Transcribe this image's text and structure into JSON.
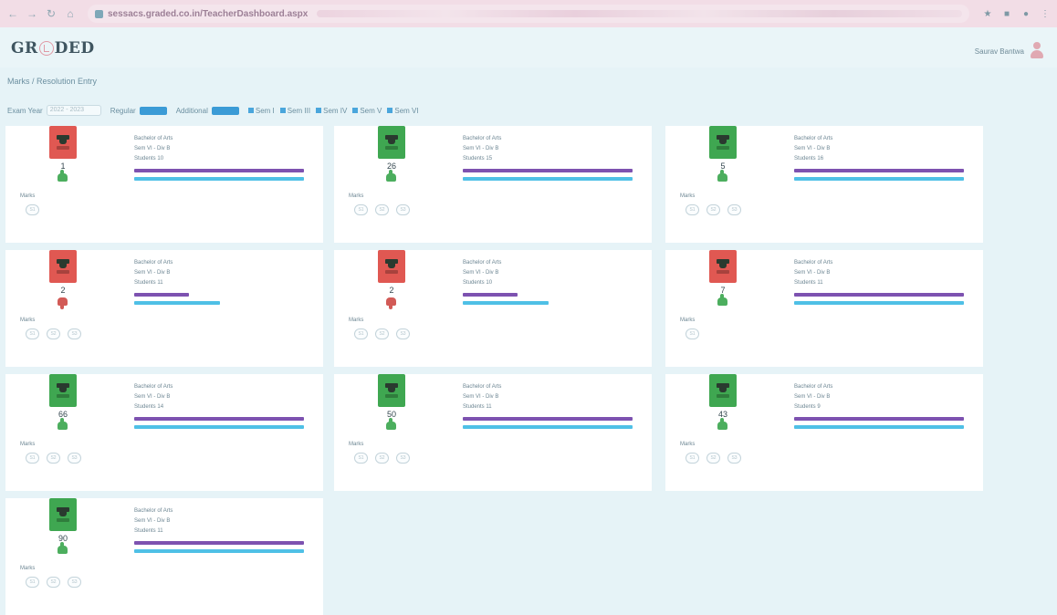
{
  "browser": {
    "url": "sessacs.graded.co.in/TeacherDashboard.aspx"
  },
  "header": {
    "logo_text_left": "GR",
    "logo_text_right": "DED",
    "user_name": "Saurav Bantwa"
  },
  "breadcrumb": "Marks / Resolution Entry",
  "filters": {
    "exam_year_label": "Exam Year",
    "exam_year_value": "2022 - 2023",
    "regular_label": "Regular",
    "additional_label": "Additional",
    "semesters": [
      "Sem I",
      "Sem III",
      "Sem IV",
      "Sem V",
      "Sem VI"
    ]
  },
  "cards": [
    {
      "count": "1",
      "status": "red",
      "thumb": "up",
      "info1": "Bachelor of Arts",
      "info2": "Sem VI - Div B",
      "info3": "Students 10",
      "chips": [
        "S1"
      ]
    },
    {
      "count": "26",
      "status": "green",
      "thumb": "up",
      "info1": "Bachelor of Arts",
      "info2": "Sem VI - Div B",
      "info3": "Students 15",
      "chips": [
        "S1",
        "S2",
        "S3"
      ]
    },
    {
      "count": "5",
      "status": "green",
      "thumb": "up",
      "info1": "Bachelor of Arts",
      "info2": "Sem VI - Div B",
      "info3": "Students 16",
      "chips": [
        "S1",
        "S2",
        "S3"
      ]
    },
    {
      "count": "2",
      "status": "red",
      "thumb": "down",
      "info1": "Bachelor of Arts",
      "info2": "Sem VI - Div B",
      "info3": "Students 11",
      "chips": [
        "S1",
        "S2",
        "S3"
      ]
    },
    {
      "count": "2",
      "status": "red",
      "thumb": "down",
      "info1": "Bachelor of Arts",
      "info2": "Sem VI - Div B",
      "info3": "Students 10",
      "chips": [
        "S1",
        "S2",
        "S3"
      ]
    },
    {
      "count": "7",
      "status": "red",
      "thumb": "up",
      "info1": "Bachelor of Arts",
      "info2": "Sem VI - Div B",
      "info3": "Students 11",
      "chips": [
        "S1"
      ]
    },
    {
      "count": "66",
      "status": "green",
      "thumb": "up",
      "info1": "Bachelor of Arts",
      "info2": "Sem VI - Div B",
      "info3": "Students 14",
      "chips": [
        "S1",
        "S2",
        "S3"
      ]
    },
    {
      "count": "50",
      "status": "green",
      "thumb": "up",
      "info1": "Bachelor of Arts",
      "info2": "Sem VI - Div B",
      "info3": "Students 11",
      "chips": [
        "S1",
        "S2",
        "S3"
      ]
    },
    {
      "count": "43",
      "status": "green",
      "thumb": "up",
      "info1": "Bachelor of Arts",
      "info2": "Sem VI - Div B",
      "info3": "Students 9",
      "chips": [
        "S1",
        "S2",
        "S3"
      ]
    },
    {
      "count": "90",
      "status": "green",
      "thumb": "up",
      "info1": "Bachelor of Arts",
      "info2": "Sem VI - Div B",
      "info3": "Students 11",
      "chips": [
        "S1",
        "S2",
        "S3"
      ]
    }
  ],
  "marks_label": "Marks",
  "colors": {
    "red": "#e05852",
    "green": "#3fa751",
    "purple_bar": "#7d52b0",
    "blue_bar": "#4fc0e6"
  }
}
